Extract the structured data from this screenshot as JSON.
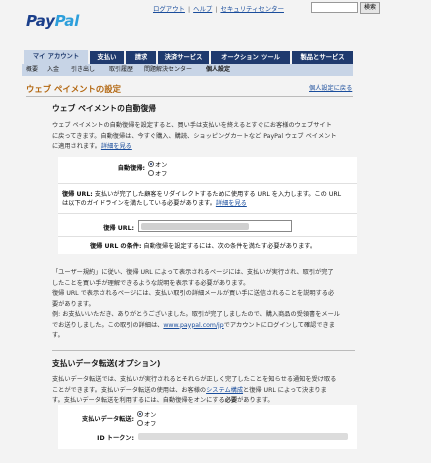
{
  "header": {
    "logo_text_dark": "Pay",
    "logo_text_light": "Pal",
    "links": [
      "ログアウト",
      "ヘルプ",
      "セキュリティセンター"
    ],
    "search_button": "検索"
  },
  "tabs": [
    "マイ アカウント",
    "支払い",
    "請求",
    "決済サービス",
    "オークション ツール",
    "製品とサービス"
  ],
  "subnav": [
    "概要",
    "入金",
    "引き出し",
    "取引履歴",
    "問題解決センター",
    "個人設定"
  ],
  "page": {
    "title": "ウェブ ペイメントの設定",
    "back_link": "個人設定に戻る"
  },
  "auto_return": {
    "title": "ウェブ ペイメントの自動復帰",
    "desc_line1": "ウェブ ペイメントの自動復帰を設定すると、買い手は支払いを終えるとすぐにお客様のウェブサイト",
    "desc_line2": "に戻ってきます。自動復帰は、今すぐ購入、購読、ショッピングカートなど PayPal ウェブ ペイメント",
    "desc_line3": "に適用されます。",
    "desc_link": "詳細を見る",
    "field_label": "自動復帰:",
    "option_on": "オン",
    "option_off": "オフ",
    "return_url_note_bold": "復帰 URL:",
    "return_url_note": " 支払いが完了した顧客をリダイレクトするために使用する URL を入力します。この URL",
    "return_url_note2": "は以下のガイドラインを満たしている必要があります。",
    "return_url_note_link": "詳細を見る",
    "return_url_label": "復帰 URL:",
    "condition_bold": "復帰 URL の条件:",
    "condition_text": " 自動復帰を設定するには、次の条件を満たす必要があります。"
  },
  "conditions_text": {
    "line1": "「ユーザー規約」に従い、復帰 URL によって表示されるページには、支払いが実行され、取引が完了",
    "line2": "したことを買い手が理解できるような説明を表示する必要があります。",
    "line3": "復帰 URL で表示されるページには、支払い取引の詳細メールが買い手に送信されることを説明する必",
    "line4": "要があります。",
    "line5": "例: お支払いいただき、ありがとうございました。取引が完了しましたので、購入商品の受領書をメール",
    "line6": "でお送りしました。この取引の詳細は、",
    "line6_link": "www.paypal.com/jp",
    "line6_end": "でアカウントにログインして確認できま",
    "line7": "す。"
  },
  "pdt": {
    "title": "支払いデータ転送(オプション)",
    "line1": "支払いデータ転送では、支払いが実行されるとそれらが正しく完了したことを知らせる通知を受け取る",
    "line2": "ことができます。支払いデータ転送の使用は、お客様の",
    "line2_link": "システム構成",
    "line2_end": "と復帰 URL によって決まりま",
    "line3": "す。支払いデータ転送を利用するには、自動復帰をオンにする",
    "line3_bold": "必要",
    "line3_end": "があります。",
    "field_label": "支払いデータ転送:",
    "option_on": "オン",
    "option_off": "オフ",
    "token_label": "ID トークン:"
  }
}
